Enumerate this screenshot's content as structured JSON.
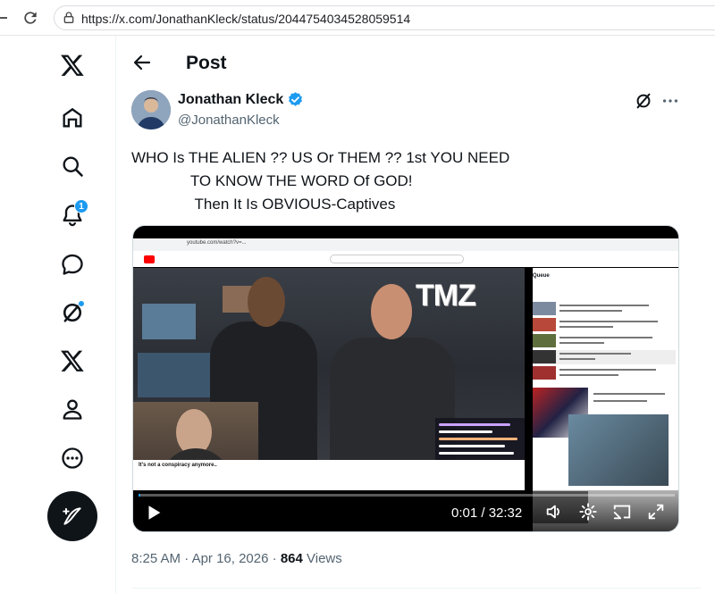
{
  "browser": {
    "url": "https://x.com/JonathanKleck/status/2044754034528059514"
  },
  "nav": {
    "items": [
      {
        "name": "x-logo-icon"
      },
      {
        "name": "home-icon"
      },
      {
        "name": "search-icon"
      },
      {
        "name": "notifications-icon",
        "badge": "1"
      },
      {
        "name": "messages-icon"
      },
      {
        "name": "grok-icon"
      },
      {
        "name": "premium-x-icon"
      },
      {
        "name": "profile-icon"
      },
      {
        "name": "more-icon"
      }
    ],
    "compose_icon": "compose-feather-icon"
  },
  "header": {
    "title": "Post"
  },
  "tweet": {
    "author_name": "Jonathan Kleck",
    "handle": "@JonathanKleck",
    "text": "WHO Is THE ALIEN ?? US Or THEM ?? 1st YOU NEED\n              TO KNOW THE WORD Of GOD!\n               Then It Is OBVIOUS-Captives",
    "time": "8:25 AM",
    "date": "Apr 16, 2026",
    "views": "864",
    "views_label": "Views"
  },
  "media": {
    "type": "video",
    "overlay_logo": "TMZ",
    "caption": "It's not a conspiracy anymore..",
    "time_display": "0:01 / 32:32",
    "progress": 0.0005,
    "queue_title": "Queue",
    "embedded_url": "youtube.com/watch?v=..."
  },
  "colors": {
    "accent": "#1d9bf0",
    "text": "#0f1419",
    "muted": "#536471"
  }
}
